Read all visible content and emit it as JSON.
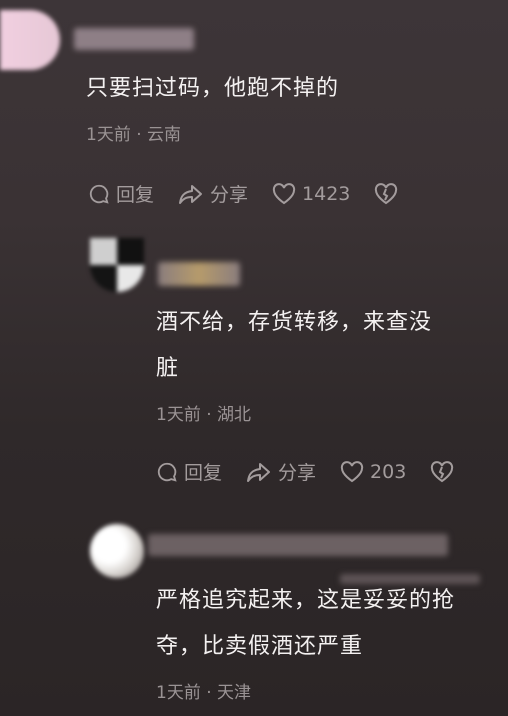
{
  "comments": [
    {
      "text": "只要扫过码，他跑不掉的",
      "meta": "1天前 · 云南",
      "reply_label": "回复",
      "share_label": "分享",
      "likes": "1423"
    },
    {
      "text_line1": "酒不给，存货转移，来查没",
      "text_line2": "脏",
      "meta": "1天前 · 湖北",
      "reply_label": "回复",
      "share_label": "分享",
      "likes": "203"
    },
    {
      "text_line1": "严格追究起来，这是妥妥的抢",
      "text_line2": "夺，比卖假酒还严重",
      "meta": "1天前 · 天津"
    }
  ],
  "icons": {
    "reply": "reply-bubble-icon",
    "share": "share-arrow-icon",
    "like": "heart-icon",
    "dislike": "broken-heart-icon"
  },
  "colors": {
    "background": "#3a3234",
    "text": "#f4f1f1",
    "meta": "#9a9394"
  }
}
